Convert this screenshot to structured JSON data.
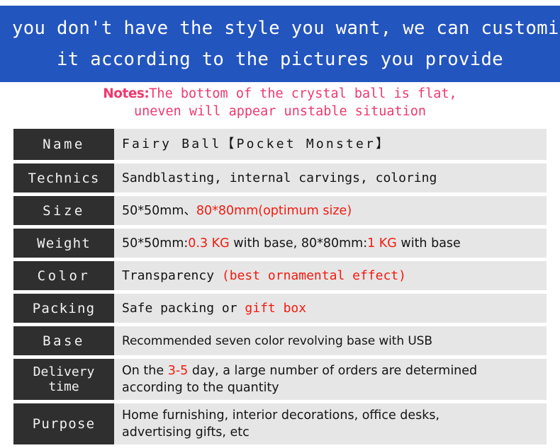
{
  "banner": {
    "line1": "If you don't have the style you want, we can customize",
    "line2": "it according to the pictures you provide",
    "background_color": "#2355bf",
    "text_color": "#ffffff"
  },
  "notes": {
    "lead": "Notes:",
    "line1_rest": "The bottom of the crystal ball is flat,",
    "line2": "uneven will appear unstable situation",
    "color": "#ed3a6e"
  },
  "table": {
    "label_background": "#2f2f2f",
    "label_color": "#f2f2f2",
    "value_background": "#e6e6e6",
    "accent_color": "#f21b0f",
    "rows": [
      {
        "label": "Name",
        "value_plain": "Fairy Ball【Pocket Monster】",
        "parts": [
          {
            "text": "Fairy Ball【Pocket Monster】",
            "color": "black"
          }
        ]
      },
      {
        "label": "Technics",
        "value_plain": "Sandblasting, internal carvings, coloring",
        "parts": [
          {
            "text": "Sandblasting, internal carvings, coloring",
            "color": "black"
          }
        ]
      },
      {
        "label": "Size",
        "value_plain": "50*50mm、80*80mm(optimum size)",
        "parts": [
          {
            "text": "50*50mm、",
            "color": "black"
          },
          {
            "text": "80*80mm(optimum size)",
            "color": "red"
          }
        ]
      },
      {
        "label": "Weight",
        "value_plain": "50*50mm:0.3 KG with base, 80*80mm:1 KG with base",
        "parts": [
          {
            "text": "50*50mm:",
            "color": "black"
          },
          {
            "text": "0.3 KG",
            "color": "red"
          },
          {
            "text": " with base, 80*80mm:",
            "color": "black"
          },
          {
            "text": "1 KG",
            "color": "red"
          },
          {
            "text": " with base",
            "color": "black"
          }
        ]
      },
      {
        "label": "Color",
        "value_plain": "Transparency (best ornamental effect)",
        "parts": [
          {
            "text": "Transparency ",
            "color": "black"
          },
          {
            "text": "(best ornamental effect)",
            "color": "red"
          }
        ]
      },
      {
        "label": "Packing",
        "value_plain": "Safe packing or gift box",
        "parts": [
          {
            "text": "Safe packing or ",
            "color": "black"
          },
          {
            "text": "gift box",
            "color": "red"
          }
        ]
      },
      {
        "label": "Base",
        "value_plain": "Recommended seven color revolving base with USB",
        "parts": [
          {
            "text": "Recommended seven color revolving base with USB",
            "color": "black"
          }
        ]
      },
      {
        "label": "Delivery time",
        "value_plain": "On the 3-5 day, a large number of orders are determined according to the quantity",
        "parts": [
          {
            "text": "On the ",
            "color": "black"
          },
          {
            "text": "3-5",
            "color": "red"
          },
          {
            "text": " day, a large number of orders are determined",
            "color": "black"
          }
        ],
        "line2": "according to the quantity"
      },
      {
        "label": "Purpose",
        "value_plain": "Home furnishing, interior decorations, office desks, advertising gifts, etc",
        "parts": [
          {
            "text": "Home furnishing, interior decorations, office desks,",
            "color": "black"
          }
        ],
        "line2": "advertising gifts, etc"
      }
    ]
  }
}
